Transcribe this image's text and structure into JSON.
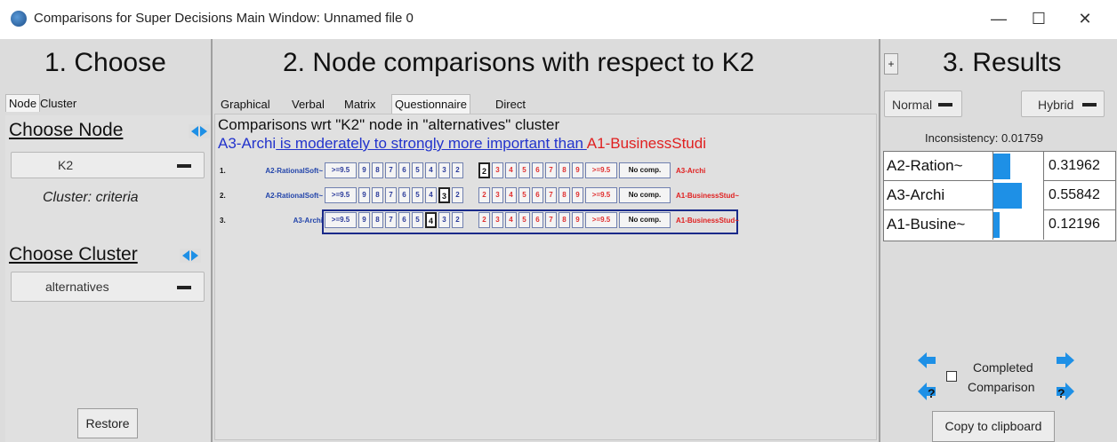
{
  "window": {
    "title": "Comparisons for Super Decisions Main Window: Unnamed file 0",
    "minimize": "—",
    "maximize": "☐",
    "close": "✕"
  },
  "choose": {
    "title": "1. Choose",
    "tabs": [
      "Node",
      "Cluster"
    ],
    "choose_node": "Choose Node",
    "node_value": "K2",
    "cluster_label": "Cluster: criteria",
    "choose_cluster": "Choose Cluster",
    "cluster_value": "alternatives",
    "restore": "Restore"
  },
  "comparisons": {
    "title": "2. Node comparisons with respect to K2",
    "tabs": [
      "Graphical",
      "Verbal",
      "Matrix",
      "Questionnaire",
      "Direct"
    ],
    "active_tab": "Questionnaire",
    "header": "Comparisons wrt \"K2\" node in \"alternatives\" cluster",
    "statement_left": "A3-Archi",
    "statement_mid": " is moderately to strongly more important than ",
    "statement_right": "A1-BusinessStudi",
    "scale_left": [
      ">=9.5",
      "9",
      "8",
      "7",
      "6",
      "5",
      "4",
      "3",
      "2"
    ],
    "scale_right": [
      "2",
      "3",
      "4",
      "5",
      "6",
      "7",
      "8",
      "9",
      ">=9.5"
    ],
    "no_comp": "No comp.",
    "rows": [
      {
        "num": "1.",
        "left": "A2-RationalSoft~",
        "right": "A3-Archi",
        "selected_side": "right",
        "selected_value": "2"
      },
      {
        "num": "2.",
        "left": "A2-RationalSoft~",
        "right": "A1-BusinessStud~",
        "selected_side": "left",
        "selected_value": "3"
      },
      {
        "num": "3.",
        "left": "A3-Archi",
        "right": "A1-BusinessStud~",
        "selected_side": "left",
        "selected_value": "4"
      }
    ]
  },
  "results": {
    "plus": "+",
    "title": "3. Results",
    "mode": "Normal",
    "method": "Hybrid",
    "inconsistency": "Inconsistency: 0.01759",
    "items": [
      {
        "label": "A2-Ration~",
        "value": "0.31962",
        "weight": 0.31962
      },
      {
        "label": "A3-Archi",
        "value": "0.55842",
        "weight": 0.55842
      },
      {
        "label": "A1-Busine~",
        "value": "0.12196",
        "weight": 0.12196
      }
    ],
    "completed_line1": "Completed",
    "completed_line2": "Comparison",
    "copy": "Copy to clipboard"
  },
  "colors": {
    "accent_blue": "#1e90e6",
    "blue_text": "#2233cc",
    "red_text": "#e02020"
  }
}
